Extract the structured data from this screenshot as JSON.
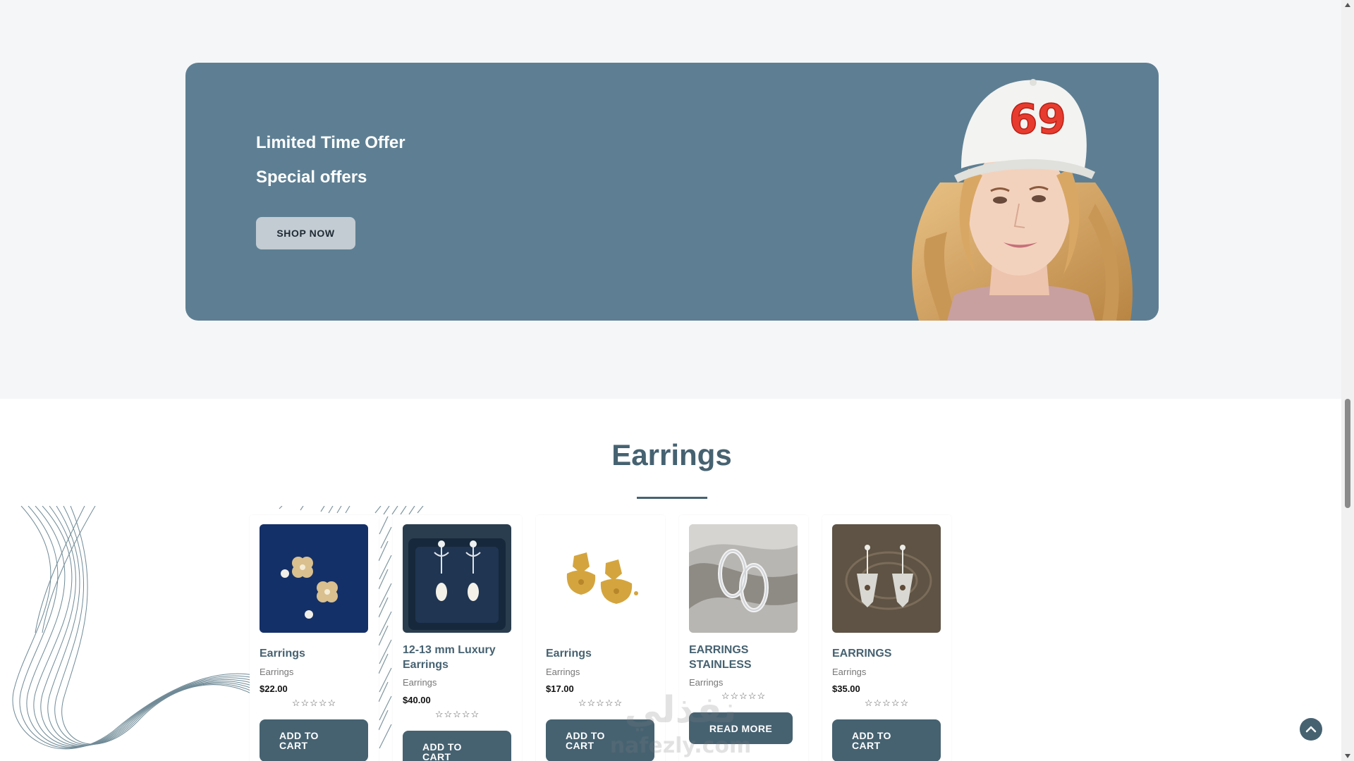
{
  "promo": {
    "title": "Limited Time Offer",
    "subtitle": "Special offers",
    "button_label": "SHOP NOW",
    "cap_number": "69"
  },
  "section": {
    "heading": "Earrings"
  },
  "products": [
    {
      "name": "Earrings",
      "category": "Earrings",
      "price": "$22.00",
      "rating": 0,
      "button": "ADD TO CART"
    },
    {
      "name": "12-13 mm Luxury Earrings",
      "category": "Earrings",
      "price": "$40.00",
      "rating": 0,
      "button": "ADD TO CART"
    },
    {
      "name": "Earrings",
      "category": "Earrings",
      "price": "$17.00",
      "rating": 0,
      "button": "ADD TO CART"
    },
    {
      "name": "EARRINGS STAINLESS",
      "category": "Earrings",
      "price": "",
      "rating": 0,
      "button": "READ MORE"
    },
    {
      "name": "EARRINGS",
      "category": "Earrings",
      "price": "$35.00",
      "rating": 0,
      "button": "ADD TO CART"
    }
  ],
  "watermark": {
    "text_ar": "نفذلي",
    "text_en": "nafezly.com"
  },
  "colors": {
    "accent": "#466271",
    "promo_bg": "#5e7f93",
    "page_bg": "#f5f6f8"
  },
  "icons": {
    "back_to_top": "chevron-up-icon",
    "rating": "star-outline-icon"
  }
}
